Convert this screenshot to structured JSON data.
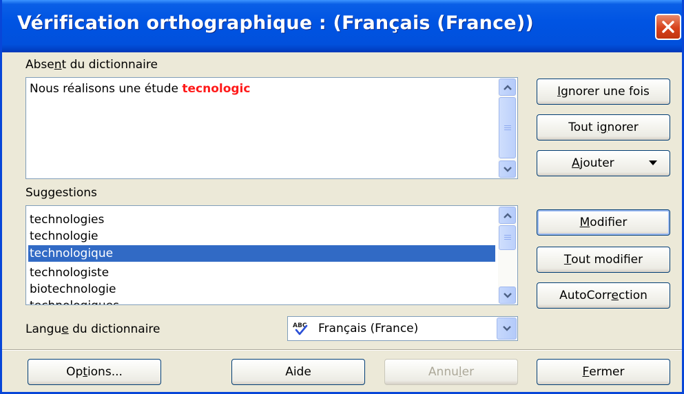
{
  "window": {
    "title": "Vérification orthographique :  (Français (France))"
  },
  "not_in_dictionary": {
    "label_pre": "Abse",
    "label_key": "n",
    "label_post": "t du dictionnaire",
    "text_before": "Nous réalisons une étude ",
    "error_word": "tecnologic"
  },
  "suggestions": {
    "label": "Suggestions",
    "items": [
      "technologies",
      "technologie",
      "technologique",
      "technologiste",
      "biotechnologie",
      "technologiques"
    ],
    "selected": "technologique"
  },
  "language": {
    "label_pre": "Langu",
    "label_key": "e",
    "label_post": " du dictionnaire",
    "value": "Français (France)",
    "icon": "abc-spellcheck-icon"
  },
  "buttons": {
    "ignore_once": {
      "pre": "",
      "key": "I",
      "post": "gnorer une fois"
    },
    "ignore_all": {
      "pre": "Tout i",
      "key": "g",
      "post": "norer"
    },
    "add": {
      "pre": "",
      "key": "A",
      "post": "jouter"
    },
    "change": {
      "pre": "",
      "key": "M",
      "post": "odifier"
    },
    "change_all": {
      "pre": "",
      "key": "T",
      "post": "out modifier"
    },
    "autocorrect": {
      "pre": "AutoCorr",
      "key": "e",
      "post": "ction"
    },
    "options": {
      "pre": "Op",
      "key": "t",
      "post": "ions..."
    },
    "help": {
      "pre": "Aide",
      "key": "",
      "post": ""
    },
    "undo": {
      "pre": "Annu",
      "key": "l",
      "post": "er"
    },
    "close": {
      "pre": "",
      "key": "F",
      "post": "ermer"
    }
  },
  "colors": {
    "titlebar": "#0054e3",
    "error_text": "#ff1a1a",
    "selection": "#316ac5",
    "close_button": "#d7421c"
  }
}
